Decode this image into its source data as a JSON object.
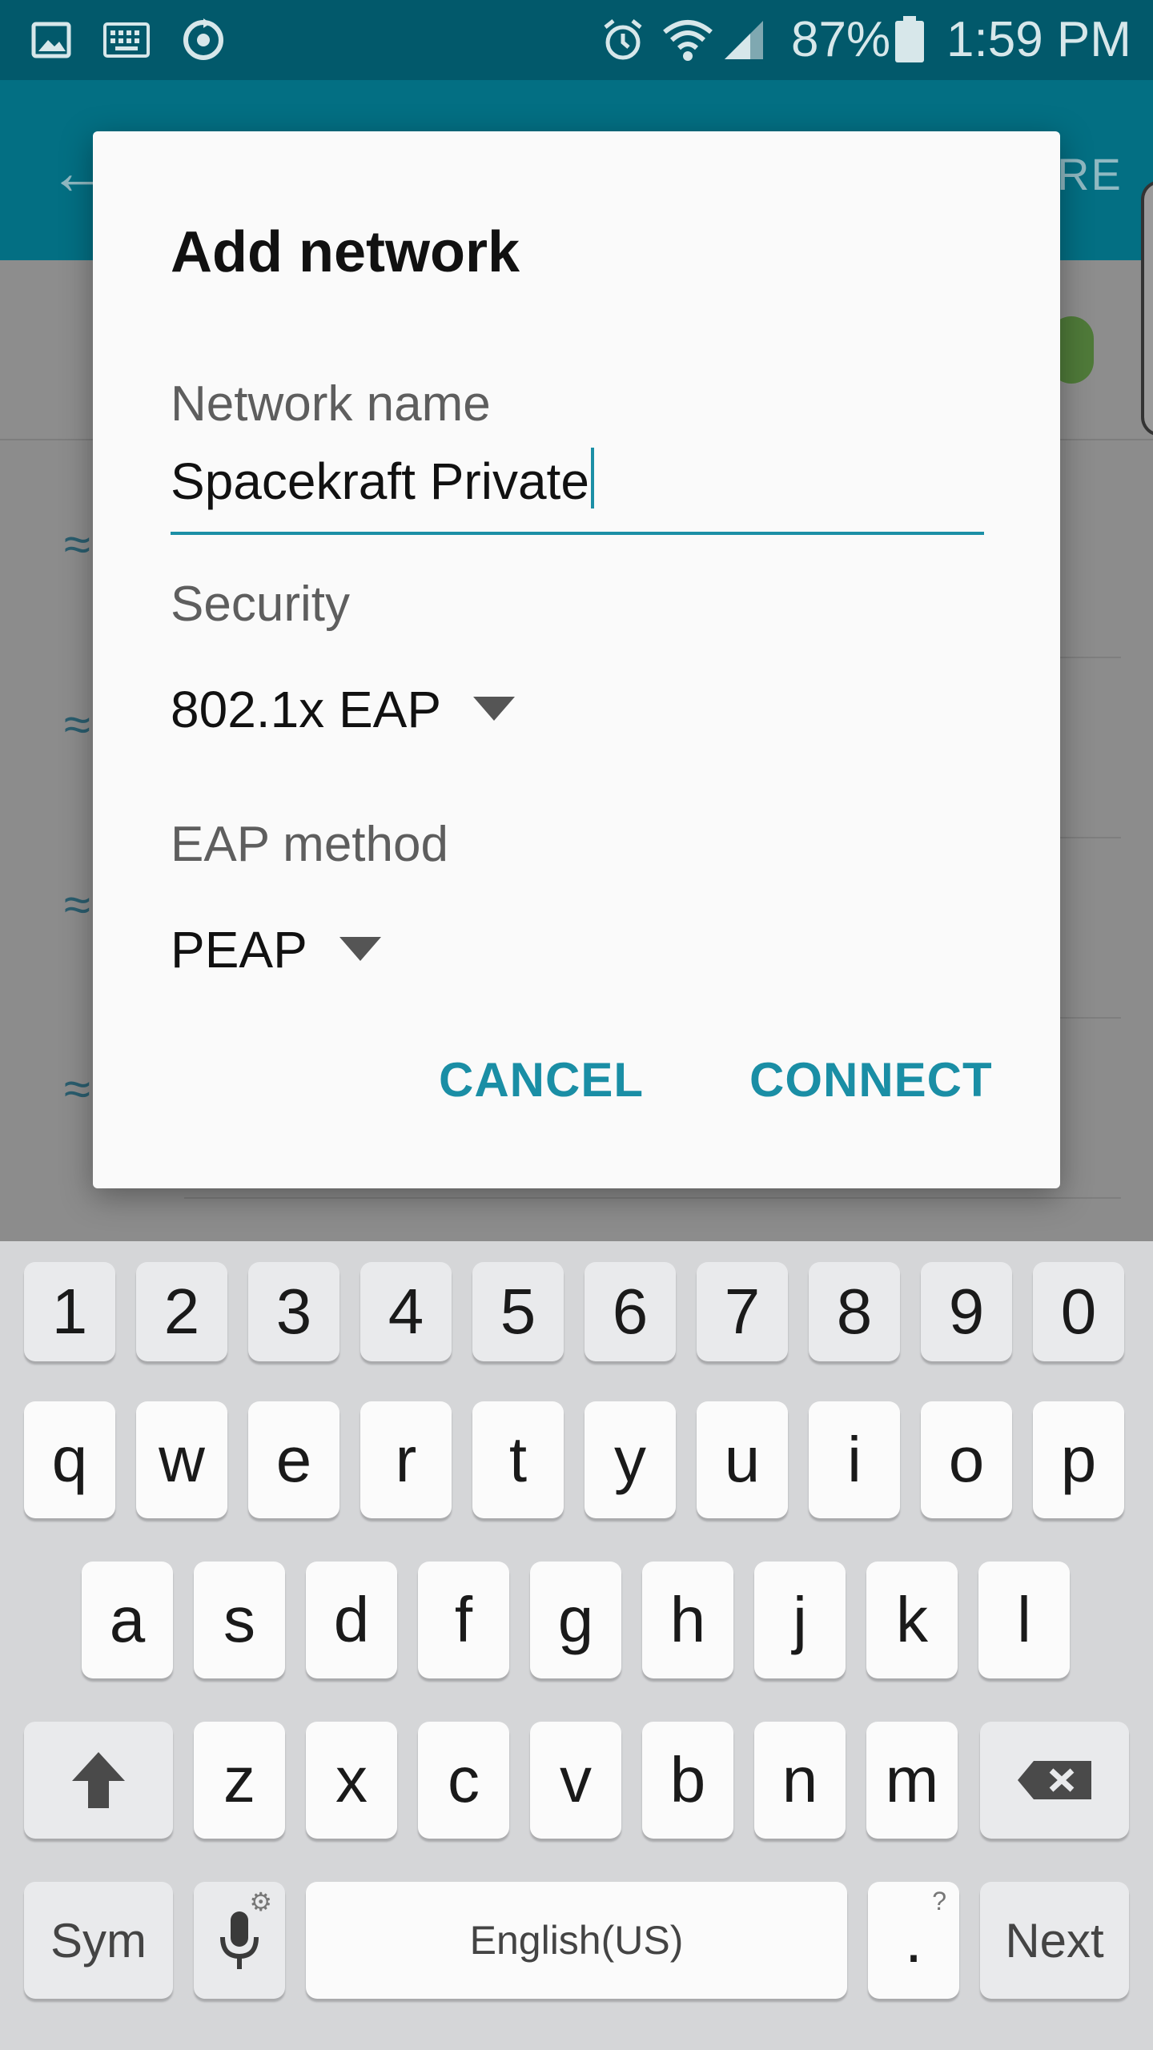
{
  "status_bar": {
    "battery": "87%",
    "time": "1:59 PM",
    "icons": [
      "gallery-icon",
      "keyboard-icon",
      "sync-icon",
      "alarm-icon",
      "wifi-icon",
      "signal-icon",
      "battery-icon"
    ]
  },
  "app_bar": {
    "back_icon": "arrow-left-icon",
    "more_label": "RE"
  },
  "dialog": {
    "title": "Add network",
    "network_name_label": "Network name",
    "network_name_value": "Spacekraft Private",
    "security_label": "Security",
    "security_value": "802.1x EAP",
    "eap_label": "EAP method",
    "eap_value": "PEAP",
    "cancel_label": "CANCEL",
    "connect_label": "CONNECT",
    "accent_color": "#1a8ea5"
  },
  "keyboard": {
    "numbers": [
      "1",
      "2",
      "3",
      "4",
      "5",
      "6",
      "7",
      "8",
      "9",
      "0"
    ],
    "row1": [
      "q",
      "w",
      "e",
      "r",
      "t",
      "y",
      "u",
      "i",
      "o",
      "p"
    ],
    "row2": [
      "a",
      "s",
      "d",
      "f",
      "g",
      "h",
      "j",
      "k",
      "l"
    ],
    "row3": [
      "z",
      "x",
      "c",
      "v",
      "b",
      "n",
      "m"
    ],
    "sym_label": "Sym",
    "space_label": "English(US)",
    "period_label": ".",
    "period_hint": "?",
    "next_label": "Next"
  }
}
